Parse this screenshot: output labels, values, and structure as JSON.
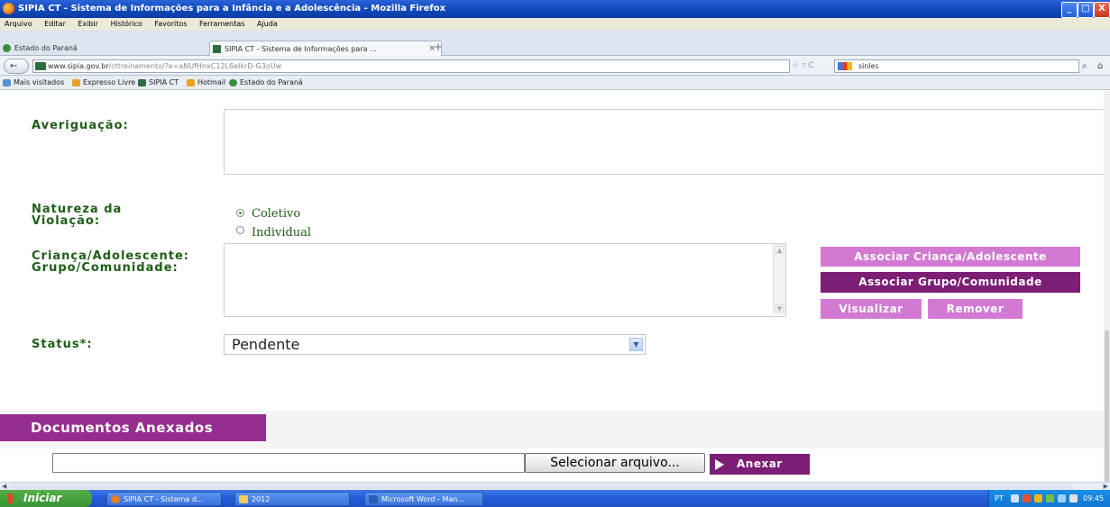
{
  "window": {
    "title": "SIPIA CT - Sistema de Informações para a Infância e a Adolescência - Mozilla Firefox",
    "controls": [
      "_",
      "□",
      "X"
    ]
  },
  "menu": [
    "Arquivo",
    "Editar",
    "Exibir",
    "Histórico",
    "Favoritos",
    "Ferramentas",
    "Ajuda"
  ],
  "tabs": [
    {
      "label": "Estado do Paraná",
      "close": "×"
    },
    {
      "label": "SIPIA CT - Sistema de Informações para ...",
      "close": "×"
    }
  ],
  "new_tab": "+",
  "nav": {
    "back": "←",
    "url_domain": "www.sipia.gov.br",
    "url_path": "/cttreinamento/?x=aNUfHnxC12L6eIkrD-G3oUw",
    "reload": "☆ ▿ C",
    "search_value": "sinles",
    "search_icon": "⌕",
    "home_icon": "⌂"
  },
  "bookmarks": [
    "Mais visitados",
    "Expresso Livre",
    "SIPIA CT",
    "Hotmail",
    "Estado do Paraná"
  ],
  "form": {
    "averiguacao_label": "Averiguação:",
    "natureza_label_line1": "Natureza da",
    "natureza_label_line2": "Violação:",
    "radio_coletivo": "Coletivo",
    "radio_individual": "Individual",
    "crianca_label_line1": "Criança/Adolescente:",
    "crianca_label_line2": "Grupo/Comunidade:",
    "btn_associar_crianca": "Associar Criança/Adolescente",
    "btn_associar_grupo": "Associar Grupo/Comunidade",
    "btn_visualizar": "Visualizar",
    "btn_remover": "Remover",
    "status_label": "Status*:",
    "status_value": "Pendente",
    "docs_header": "Documentos Anexados",
    "file_button": "Selecionar arquivo...",
    "anexar_button": "Anexar"
  },
  "taskbar": {
    "start": "Iniciar",
    "tasks": [
      "SIPIA CT - Sistema d...",
      "2012",
      "Microsoft Word - Man..."
    ],
    "tray_lang": "PT",
    "clock": "09:45"
  }
}
